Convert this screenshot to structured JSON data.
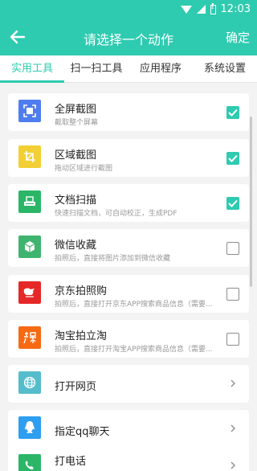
{
  "status_bar": {
    "time": "12:03"
  },
  "header": {
    "title": "请选择一个动作",
    "confirm_label": "确定"
  },
  "tabs": [
    {
      "label": "实用工具",
      "active": true
    },
    {
      "label": "扫一扫工具",
      "active": false
    },
    {
      "label": "应用程序",
      "active": false
    },
    {
      "label": "系统设置",
      "active": false
    }
  ],
  "items": [
    {
      "name": "全屏截图",
      "desc": "截取整个屏幕",
      "icon": "fullscreen-screenshot-icon",
      "color": "#4f7df0",
      "control": "checkbox",
      "checked": true
    },
    {
      "name": "区域截图",
      "desc": "拖动区域进行截图",
      "icon": "crop-icon",
      "color": "#f1cf35",
      "control": "checkbox",
      "checked": true
    },
    {
      "name": "文档扫描",
      "desc": "快速扫描文档，可自动校正，生成PDF",
      "icon": "scanner-icon",
      "color": "#2bb667",
      "control": "checkbox",
      "checked": true
    },
    {
      "name": "微信收藏",
      "desc": "拍照后，直接将图片添加到微信收藏",
      "icon": "cube-icon",
      "color": "#3eb46f",
      "control": "checkbox",
      "checked": false
    },
    {
      "name": "京东拍照购",
      "desc": "拍照后，直接打开京东APP搜索商品信息（需要...",
      "icon": "jd-dog-icon",
      "color": "#e62727",
      "control": "checkbox",
      "checked": false
    },
    {
      "name": "淘宝拍立淘",
      "desc": "拍照后，直接打开淘宝APP搜索商品信息（需要...",
      "icon": "taobao-icon",
      "color": "#f66a14",
      "control": "checkbox",
      "checked": false
    },
    {
      "name": "打开网页",
      "desc": "",
      "icon": "globe-icon",
      "color": "#55bccc",
      "control": "chevron",
      "checked": false
    },
    {
      "name": "指定qq聊天",
      "desc": "",
      "icon": "qq-penguin-icon",
      "color": "#2d9ef0",
      "control": "chevron",
      "checked": false
    },
    {
      "name": "打电话",
      "desc": "",
      "icon": "phone-icon",
      "color": "#2bb667",
      "control": "chevron",
      "checked": false
    }
  ],
  "colors": {
    "accent": "#2ecbb0"
  }
}
